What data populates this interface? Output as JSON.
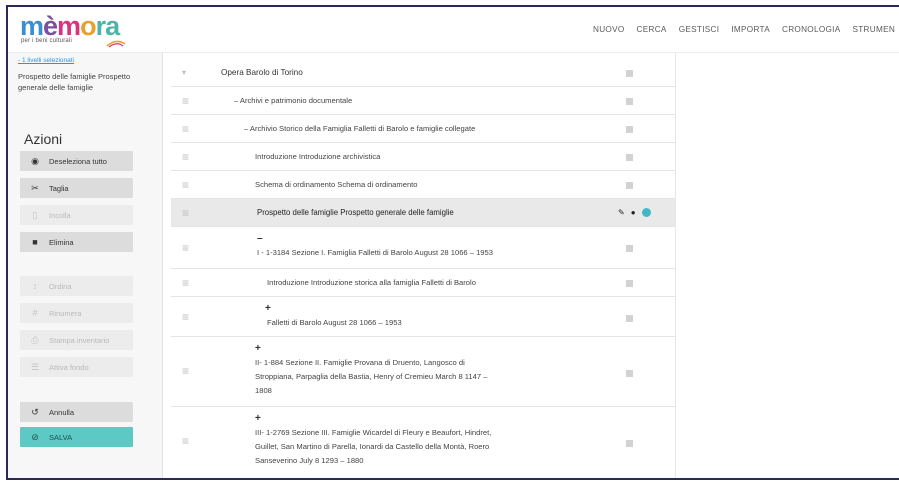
{
  "app": {
    "logo_text": [
      "m",
      "è",
      "m",
      "o",
      "ra"
    ],
    "logo_tagline": "per i beni culturali"
  },
  "nav": {
    "items": [
      "NUOVO",
      "CERCA",
      "GESTISCI",
      "IMPORTA",
      "CRONOLOGIA",
      "STRUMEN"
    ]
  },
  "sidebar": {
    "selected_link": "- 1 livelli selezionati",
    "selected_desc": "Prospetto delle famiglie Prospetto generale delle famiglie",
    "azioni_title": "Azioni",
    "actions": [
      {
        "label": "Deseleziona tutto",
        "icon": "target-icon",
        "state": "active"
      },
      {
        "label": "Taglia",
        "icon": "scissors-icon",
        "state": "active"
      },
      {
        "label": "Incolla",
        "icon": "paste-icon",
        "state": "disabled"
      },
      {
        "label": "Elimina",
        "icon": "trash-icon",
        "state": "active"
      },
      {
        "label": "Ordina",
        "icon": "sort-icon",
        "state": "disabled"
      },
      {
        "label": "Rinumera",
        "icon": "renumber-icon",
        "state": "disabled"
      },
      {
        "label": "Stampa inventario",
        "icon": "print-icon",
        "state": "disabled"
      },
      {
        "label": "Attiva fondo",
        "icon": "list-icon",
        "state": "disabled"
      },
      {
        "label": "Annulla",
        "icon": "undo-icon",
        "state": "active"
      },
      {
        "label": "SALVA",
        "icon": "save-icon",
        "state": "teal"
      }
    ]
  },
  "tree": {
    "rows": [
      {
        "toggle": "",
        "text": "Opera Barolo di Torino",
        "kind": "root"
      },
      {
        "toggle": "",
        "text": "– Archivi e patrimonio documentale",
        "kind": "normal"
      },
      {
        "toggle": "",
        "text": "– Archivio Storico della Famiglia Falletti di Barolo e famiglie collegate",
        "kind": "normal"
      },
      {
        "toggle": "",
        "text": "Introduzione Introduzione archivistica",
        "kind": "normal"
      },
      {
        "toggle": "",
        "text": "Schema di ordinamento Schema di ordinamento",
        "kind": "normal"
      },
      {
        "toggle": "",
        "text": "Prospetto delle famiglie Prospetto generale delle famiglie",
        "kind": "selected"
      },
      {
        "toggle": "–",
        "text": "I - 1-3184 Sezione I. Famiglia Falletti di Barolo August 28 1066 – 1953",
        "kind": "normal"
      },
      {
        "toggle": "",
        "text": "Introduzione Introduzione storica alla famiglia Falletti di Barolo",
        "kind": "normal"
      },
      {
        "toggle": "+",
        "text": "Falletti di Barolo August 28 1066 – 1953",
        "kind": "normal"
      },
      {
        "toggle": "+",
        "lines": [
          "II- 1-884 Sezione II. Famiglie Provana di Druento, Langosco di",
          "Stroppiana, Parpaglia della Bastia, Henry of Cremieu March 8 1147 –",
          "1808"
        ],
        "kind": "normal"
      },
      {
        "toggle": "+",
        "lines": [
          "III- 1-2769 Sezione III. Famiglie Wicardel di Fleury e Beaufort, Hindret,",
          "Guillet, San Martino di Parella, Ionardi da Castello della Montà, Roero",
          "Sanseverino July 8 1293 – 1880"
        ],
        "kind": "normal"
      }
    ]
  }
}
